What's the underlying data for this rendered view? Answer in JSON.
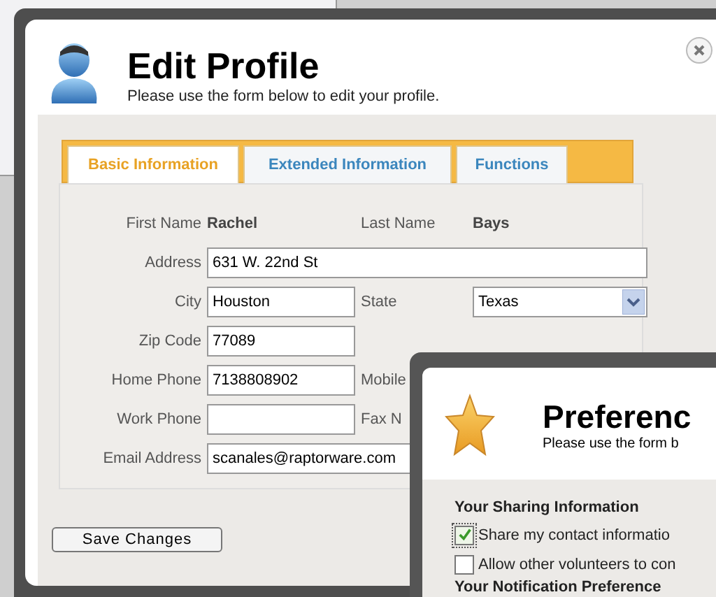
{
  "dialog": {
    "title": "Edit Profile",
    "subtitle": "Please use the form below to edit your profile."
  },
  "tabs": [
    {
      "label": "Basic Information",
      "selected": true
    },
    {
      "label": "Extended Information",
      "selected": false
    },
    {
      "label": "Functions",
      "selected": false
    }
  ],
  "rows": [
    {
      "cells": [
        {
          "kind": "static",
          "label": "First Name",
          "value": "Rachel"
        },
        {
          "kind": "static",
          "label": "Last Name",
          "value": "Bays"
        }
      ]
    },
    {
      "cells": [
        {
          "kind": "wide-input",
          "label": "Address",
          "value": "631 W. 22nd St"
        }
      ]
    },
    {
      "cells": [
        {
          "kind": "input",
          "label": "City",
          "value": "Houston"
        },
        {
          "kind": "select",
          "label": "State",
          "value": "Texas"
        }
      ]
    },
    {
      "cells": [
        {
          "kind": "input",
          "label": "Zip Code",
          "value": "77089"
        }
      ]
    },
    {
      "cells": [
        {
          "kind": "input",
          "label": "Home Phone",
          "value": "7138808902"
        },
        {
          "kind": "label",
          "label": "Mobile"
        }
      ]
    },
    {
      "cells": [
        {
          "kind": "input",
          "label": "Work Phone"
        },
        {
          "kind": "label",
          "label": "Fax N"
        }
      ]
    },
    {
      "cells": [
        {
          "kind": "wide-input",
          "label": "Email Address",
          "value": "scanales@raptorware.com"
        }
      ]
    }
  ],
  "save_button": "Save Changes",
  "preferences": {
    "title": "Preferenc",
    "subtitle": "Please use the form b",
    "sections": [
      {
        "heading": "Your Sharing Information",
        "options": [
          {
            "label": "Share my contact informatio",
            "checked": true
          },
          {
            "label": "Allow other volunteers to con",
            "checked": false
          }
        ]
      },
      {
        "heading": "Your Notification Preference"
      }
    ]
  }
}
